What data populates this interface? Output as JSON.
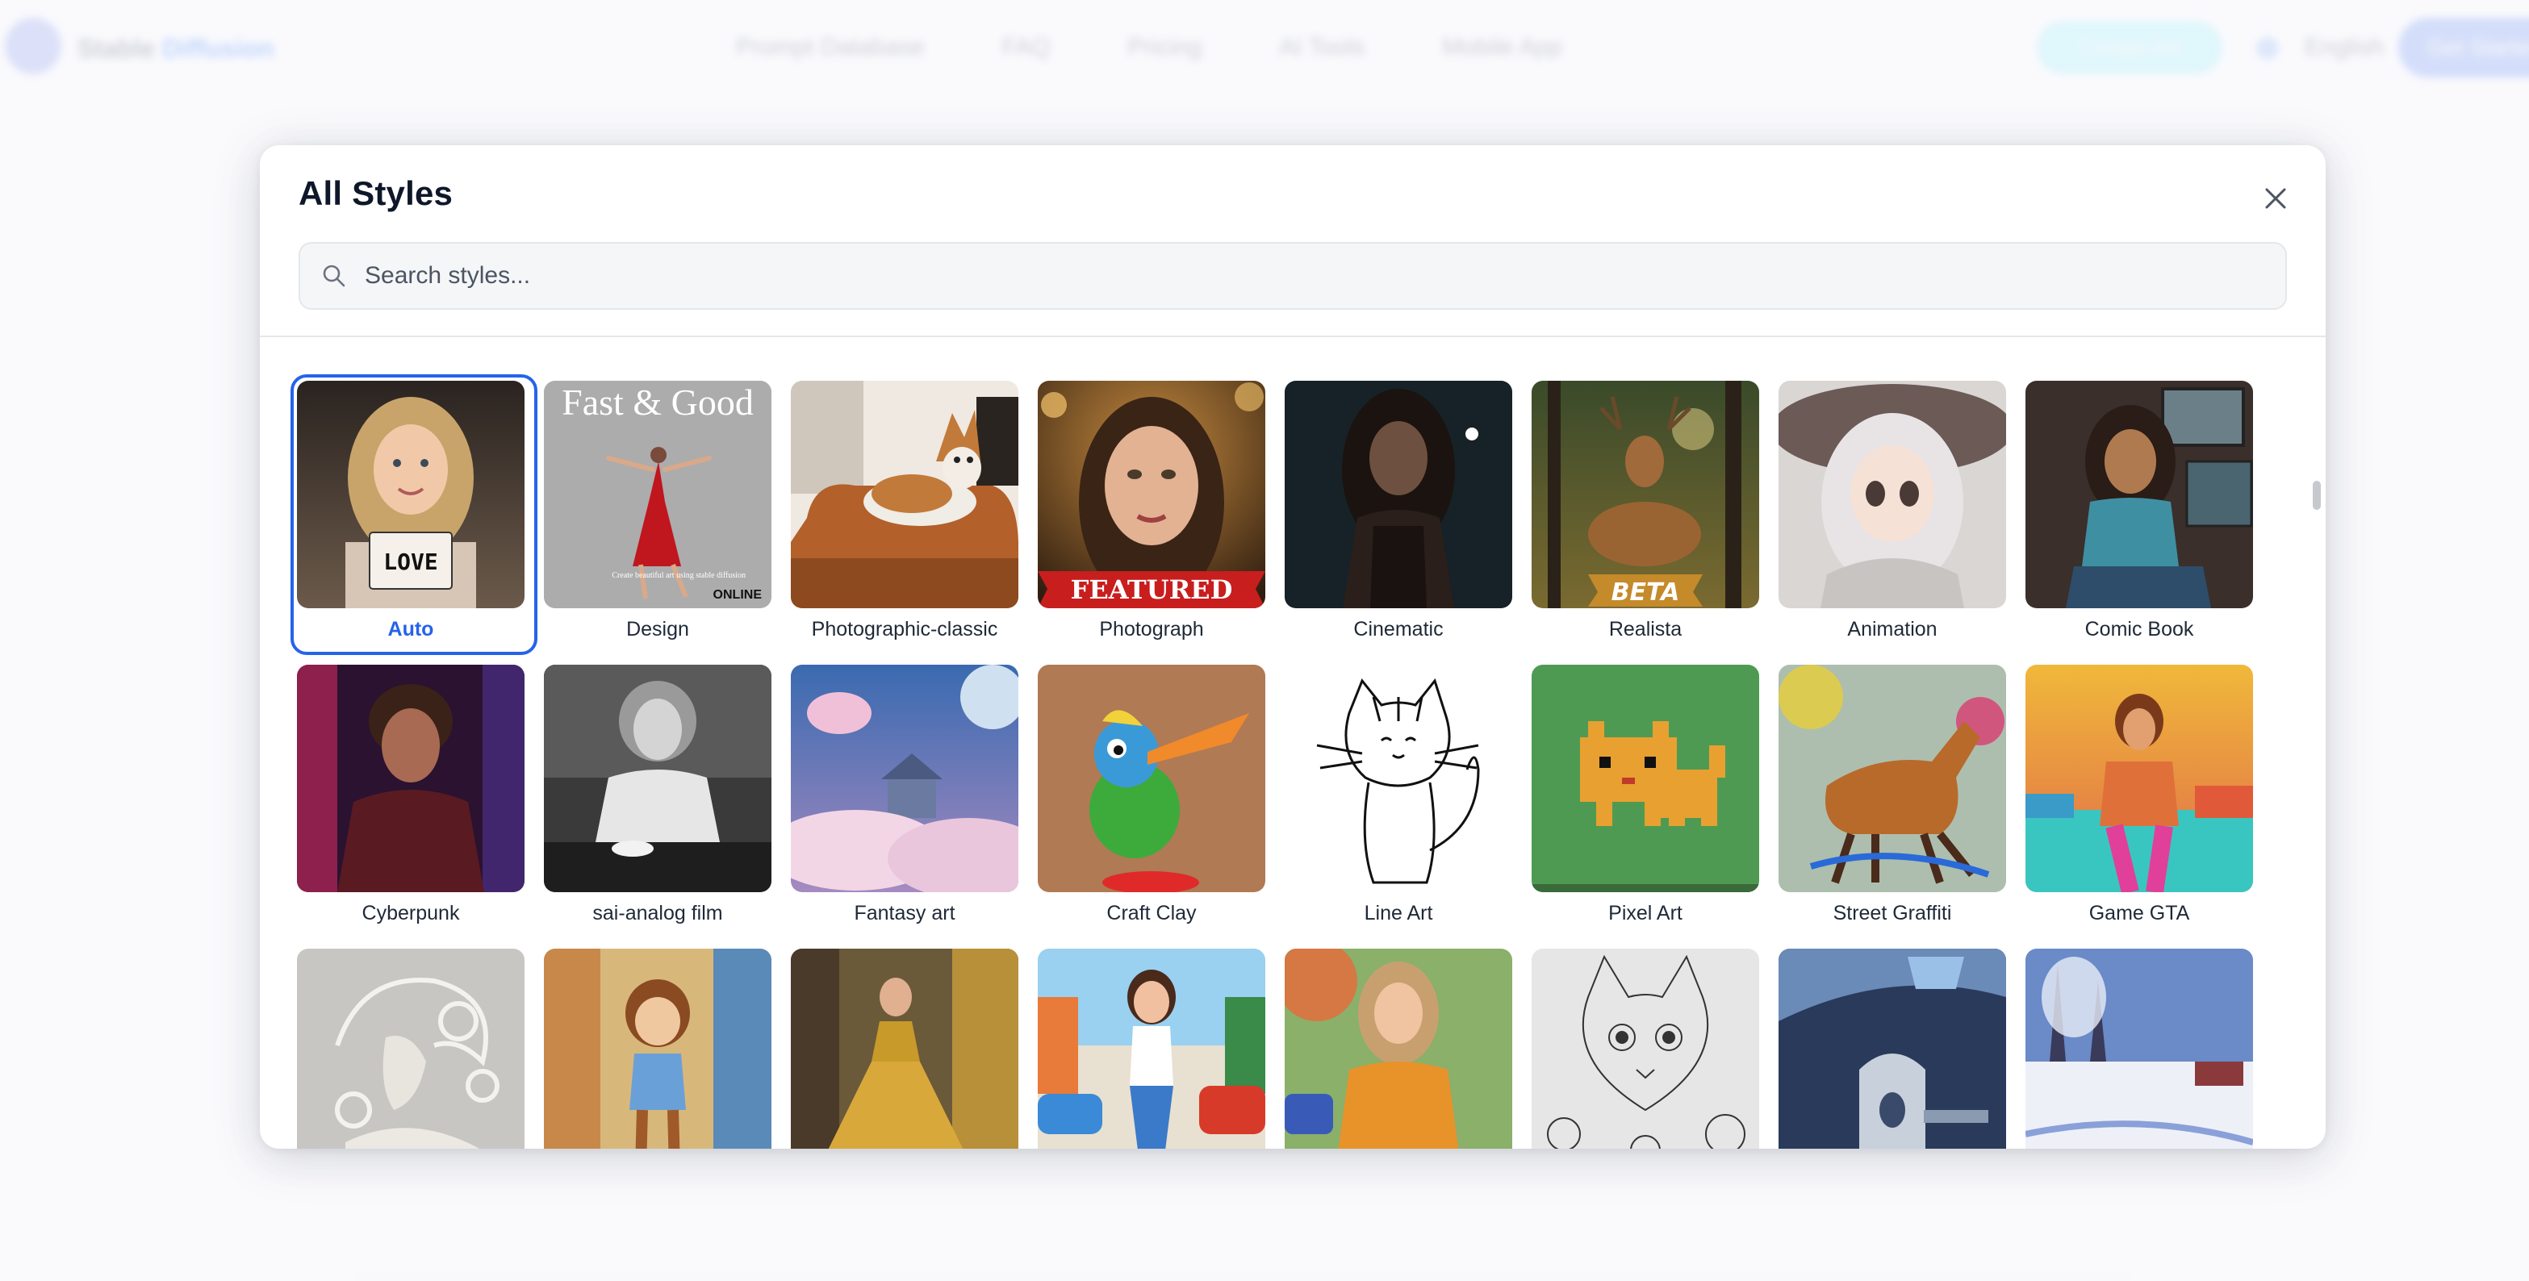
{
  "background": {
    "brand": "Stable",
    "brand_accent": "Diffusion",
    "nav": [
      "Prompt Database",
      "FAQ",
      "Pricing",
      "AI Tools",
      "Mobile App"
    ],
    "cta": "Create Art",
    "language": "English",
    "signup": "Get Started"
  },
  "modal": {
    "title": "All Styles",
    "search_placeholder": "Search styles...",
    "selected": "Auto",
    "styles": [
      {
        "label": "Auto",
        "badge": "LOVE"
      },
      {
        "label": "Design",
        "headline": "Fast & Good",
        "caption": "Create beautiful art using stable diffusion",
        "tag": "ONLINE"
      },
      {
        "label": "Photographic-classic"
      },
      {
        "label": "Photograph",
        "banner": "FEATURED"
      },
      {
        "label": "Cinematic"
      },
      {
        "label": "Realista",
        "banner": "BETA"
      },
      {
        "label": "Animation"
      },
      {
        "label": "Comic Book"
      },
      {
        "label": "Cyberpunk"
      },
      {
        "label": "sai-analog film"
      },
      {
        "label": "Fantasy art"
      },
      {
        "label": "Craft Clay"
      },
      {
        "label": "Line Art"
      },
      {
        "label": "Pixel Art"
      },
      {
        "label": "Street Graffiti"
      },
      {
        "label": "Game GTA"
      },
      {
        "label": ""
      },
      {
        "label": ""
      },
      {
        "label": ""
      },
      {
        "label": ""
      },
      {
        "label": ""
      },
      {
        "label": ""
      },
      {
        "label": ""
      },
      {
        "label": ""
      }
    ]
  },
  "colors": {
    "accent": "#2563eb",
    "modal_bg": "#ffffff",
    "search_bg": "#f5f6f8"
  }
}
